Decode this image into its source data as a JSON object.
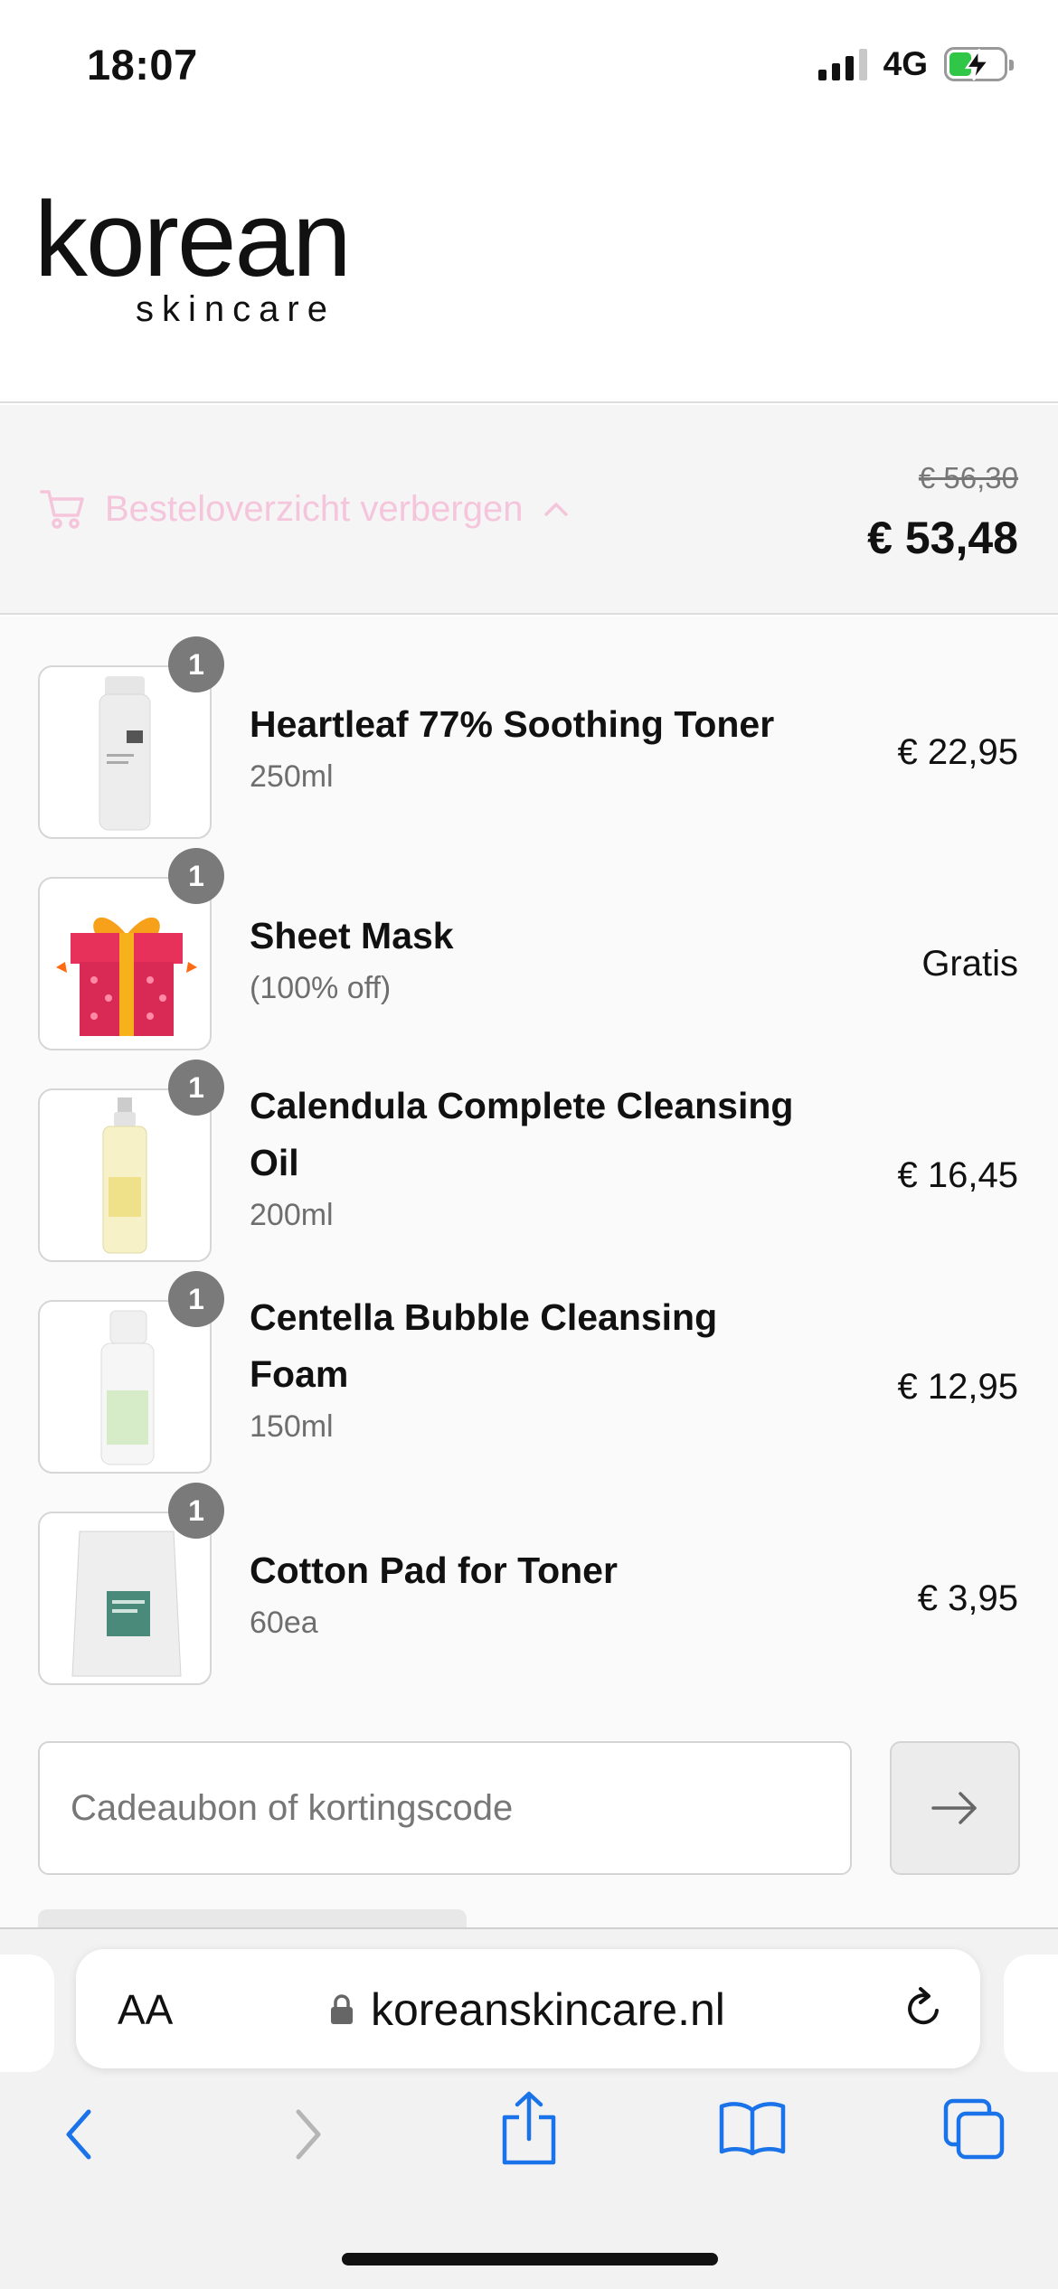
{
  "status_bar": {
    "time": "18:07",
    "network": "4G"
  },
  "brand": {
    "logo_main": "korean",
    "logo_sub": "skincare"
  },
  "order_summary": {
    "toggle_label": "Besteloverzicht verbergen",
    "original_price": "€ 56,30",
    "total_price": "€ 53,48",
    "accent_color": "#f5c5dc"
  },
  "items": [
    {
      "quantity": "1",
      "name": "Heartleaf 77% Soothing Toner",
      "variant": "250ml",
      "price": "€ 22,95"
    },
    {
      "quantity": "1",
      "name": "Sheet Mask",
      "variant": "(100% off)",
      "price": "Gratis"
    },
    {
      "quantity": "1",
      "name": "Calendula Complete Cleansing Oil",
      "variant": "200ml",
      "price": "€ 16,45"
    },
    {
      "quantity": "1",
      "name": "Centella Bubble Cleansing Foam",
      "variant": "150ml",
      "price": "€ 12,95"
    },
    {
      "quantity": "1",
      "name": "Cotton Pad for Toner",
      "variant": "60ea",
      "price": "€ 3,95"
    }
  ],
  "discount": {
    "placeholder": "Cadeaubon of kortingscode",
    "submit_icon": "arrow-right-icon"
  },
  "browser": {
    "text_size_label": "AA",
    "url": "koreanskincare.nl",
    "icons": [
      "back-icon",
      "forward-icon",
      "share-icon",
      "bookmarks-icon",
      "tabs-icon"
    ]
  }
}
